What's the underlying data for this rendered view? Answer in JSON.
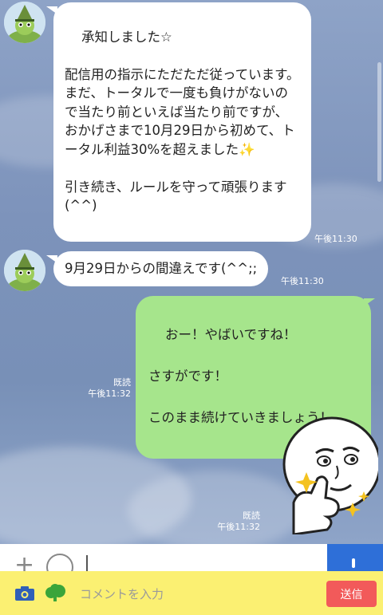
{
  "messages": [
    {
      "direction": "incoming",
      "text": "承知しました☆\n\n配信用の指示にただただ従っています。\nまだ、トータルで一度も負けがないので当たり前といえば当たり前ですが、おかげさまで10月29日から初めて、トータル利益30%を超えました✨\n\n引き続き、ルールを守って頑張ります(^^)",
      "time": "午後11:30"
    },
    {
      "direction": "incoming",
      "text": "9月29日からの間違えです(^^;;",
      "time": "午後11:30"
    },
    {
      "direction": "outgoing",
      "text": "おー！やばいですね！\n\nさすがです！\n\nこのまま続けていきましょう！",
      "read": "既読",
      "time": "午後11:32"
    },
    {
      "direction": "outgoing",
      "sticker": "smug-face-thumbs-up-sticker",
      "read": "既読",
      "time": "午後11:32"
    }
  ],
  "composer": {
    "placeholder": "コメントを入力",
    "send_label": "送信"
  },
  "colors": {
    "background": "#7e93b8",
    "incoming_bubble": "#ffffff",
    "outgoing_bubble": "#a6e58c",
    "bottom_bar": "#fbf072",
    "send_button": "#f25a5a",
    "input_accent": "#2e6fd8"
  }
}
